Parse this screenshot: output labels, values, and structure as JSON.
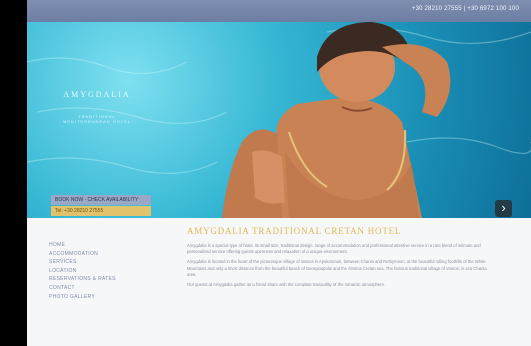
{
  "topbar": {
    "contact": "+30 28210 27555 | +30 6972 100 100"
  },
  "logo": {
    "name": "AMYGDALIA",
    "sub": "TRADITIONAL MEDITERRANEAN HOTEL"
  },
  "hero": {
    "next_label": "›"
  },
  "booking": {
    "line1": "BOOK NOW · CHECK AVAILABILITY",
    "line2": "Tel: +30 28210 27555"
  },
  "nav": {
    "items": [
      "HOME",
      "ACCOMMODATION",
      "SERVICES",
      "LOCATION",
      "RESERVATIONS & RATES",
      "CONTACT",
      "PHOTO GALLERY"
    ]
  },
  "main": {
    "title": "AMYGDALIA TRADITIONAL CRETAN HOTEL",
    "p1": "Amygdalia is a special type of hotel, its small size, traditional design, range of accommodation and professional attentive service in a rare blend of intimate and personalized service offering guests openness and relaxation of a unique environment.",
    "p2": "Amygdalia is located in the heart of the picturesque village of Vamos in Apokoronas, between Chania and Rethymnon, at the beautiful rolling foothills of the White Mountains and only a short distance from the beautiful beach of Georgioupolis and the Almiros Cretan sea. The famous traditional village of Vamos, in eco Chania area.",
    "p3": "Our guests at Amygdalia gather as a friend share with the complete tranquillity of the romantic atmosphere."
  },
  "colors": {
    "topbar": "#7587aa",
    "title": "#e0b84d",
    "nav": "#7d8bb0"
  }
}
